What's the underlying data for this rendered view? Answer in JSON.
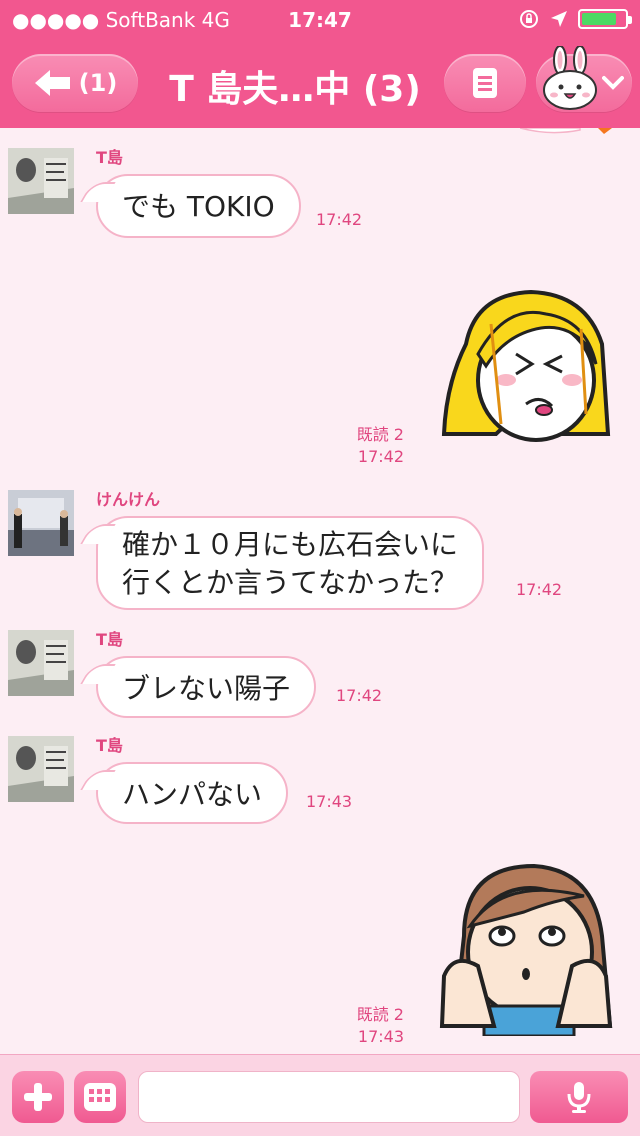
{
  "status_bar": {
    "carrier": "●●●●● SoftBank  4G",
    "time": "17:47"
  },
  "nav": {
    "back_label": "(1)",
    "title": "T 島夫…中 (3)"
  },
  "messages": [
    {
      "sender": "T島",
      "text_lines": [
        "でも TOKIO"
      ],
      "time": "17:42"
    },
    {
      "read": "既読 2",
      "time": "17:42"
    },
    {
      "sender": "けんけん",
      "text_lines": [
        "確か１０月にも広石会いに",
        "行くとか言うてなかった？"
      ],
      "time": "17:42"
    },
    {
      "sender": "T島",
      "text_lines": [
        "ブレない陽子"
      ],
      "time": "17:42"
    },
    {
      "sender": "T島",
      "text_lines": [
        "ハンパない"
      ],
      "time": "17:43"
    },
    {
      "read": "既読 2",
      "time": "17:43"
    }
  ],
  "input": {
    "placeholder": ""
  },
  "colors": {
    "brand": "#f2578f",
    "background": "#fdeef4",
    "accent_text": "#e0467f"
  },
  "icons": [
    "arrow-left-icon",
    "menu-list-icon",
    "rabbit-avatar-icon",
    "chevron-down-icon",
    "plus-icon",
    "keyboard-icon",
    "microphone-icon",
    "location-arrow-icon",
    "rotation-lock-icon"
  ]
}
